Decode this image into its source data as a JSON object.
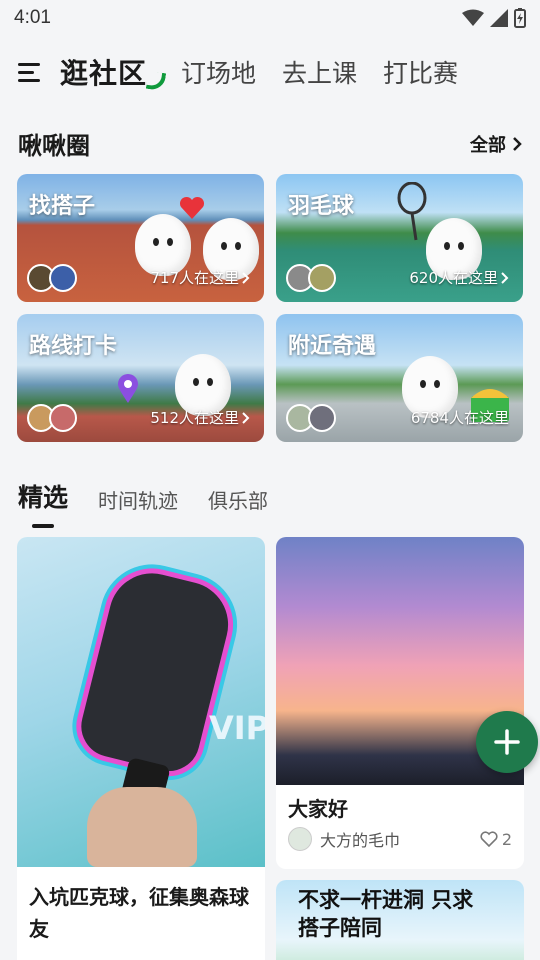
{
  "status": {
    "time": "4:01",
    "icons": [
      "wifi-icon",
      "signal-icon",
      "battery-icon"
    ]
  },
  "nav": {
    "active": "逛社区",
    "items": [
      "订场地",
      "去上课",
      "打比赛"
    ]
  },
  "circles": {
    "title": "啾啾圈",
    "see_all": "全部",
    "cards": [
      {
        "title": "找搭子",
        "count": "717人在这里"
      },
      {
        "title": "羽毛球",
        "count": "620人在这里"
      },
      {
        "title": "路线打卡",
        "count": "512人在这里"
      },
      {
        "title": "附近奇遇",
        "count": "6784人在这里"
      }
    ]
  },
  "feed": {
    "tabs": [
      "精选",
      "时间轨迹",
      "俱乐部"
    ],
    "posts": [
      {
        "title": "入坑匹克球，征集奥森球友",
        "image_text": "VIP"
      },
      {
        "title": "大家好",
        "author": "大方的毛巾",
        "likes": "2"
      },
      {
        "image_text": "不求一杆进洞 只求搭子陪同"
      }
    ]
  },
  "colors": {
    "accent": "#0f9a3c",
    "fab": "#1f7a4c"
  }
}
